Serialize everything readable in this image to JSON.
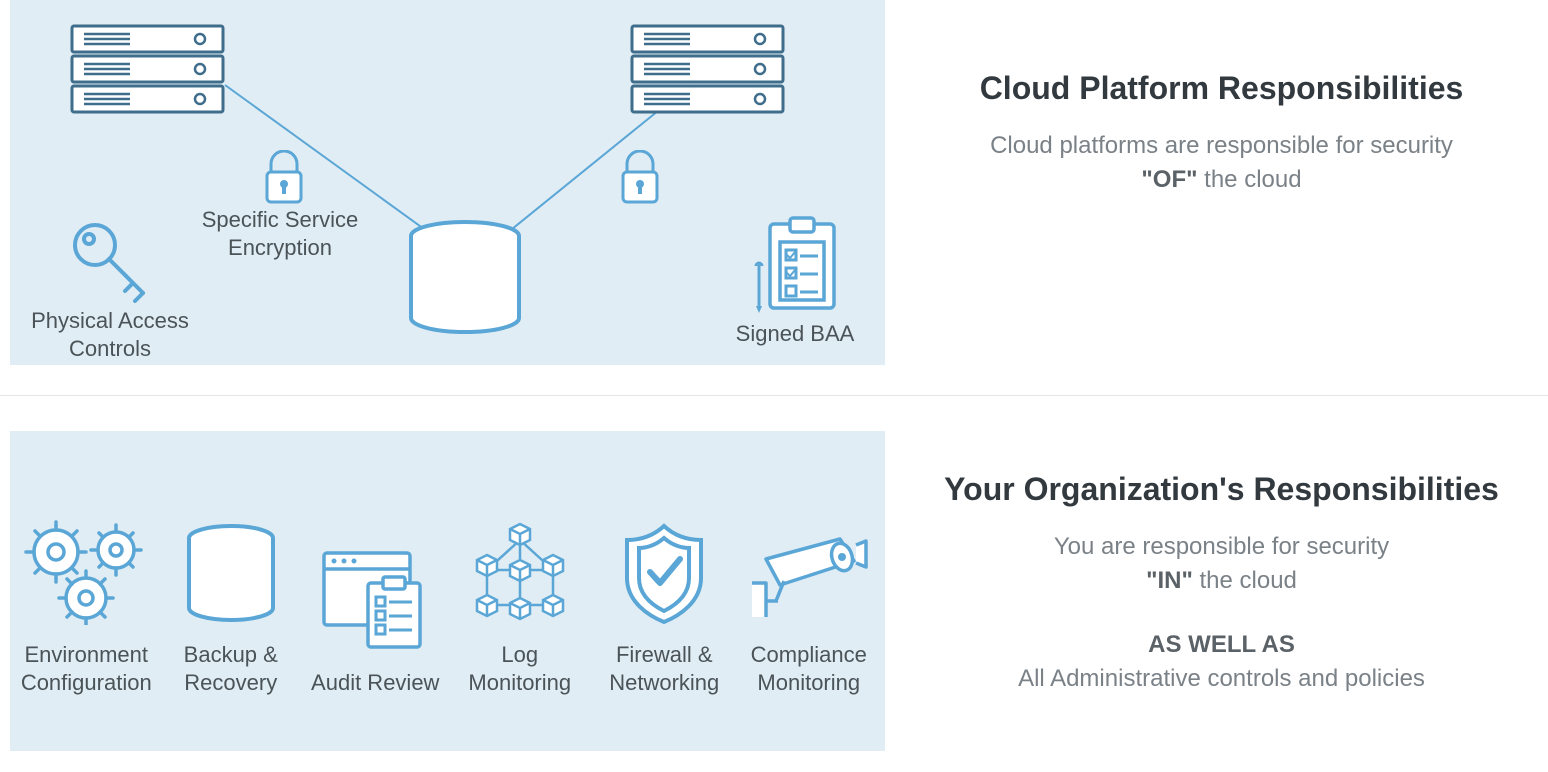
{
  "top": {
    "title": "Cloud Platform Responsibilities",
    "subtitle_pre": "Cloud platforms are responsible for security ",
    "subtitle_of": "\"OF\"",
    "subtitle_post": " the cloud",
    "labels": {
      "physical_access": "Physical Access Controls",
      "encryption": "Specific Service Encryption",
      "signed_baa": "Signed BAA"
    }
  },
  "bottom": {
    "title": "Your Organization's Responsibilities",
    "sub_line1": "You are responsible for security",
    "sub_in": "\"IN\"",
    "sub_line2": " the cloud",
    "aswell": "AS WELL AS",
    "admin": "All Administrative controls and policies",
    "items": {
      "env": "Environment Configuration",
      "backup": "Backup & Recovery",
      "audit": "Audit Review",
      "log": "Log Monitoring",
      "firewall": "Firewall & Networking",
      "compliance": "Compliance Monitoring"
    }
  }
}
